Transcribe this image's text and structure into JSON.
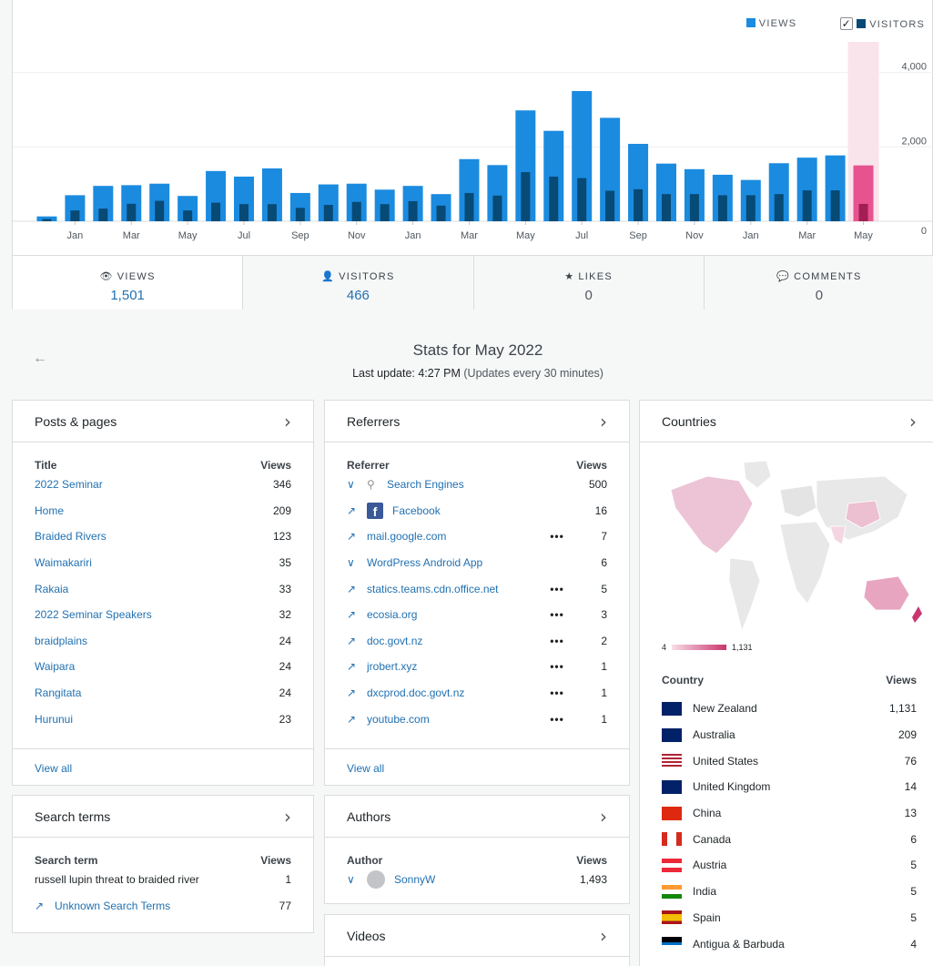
{
  "legend": {
    "views": "VIEWS",
    "visitors": "VISITORS",
    "visitors_checked": "✓"
  },
  "colors": {
    "views": "#1b8be0",
    "visitors": "#064a75",
    "highlight_views": "#e6538e",
    "highlight_visitors": "#a21e55",
    "highlight_band": "#f9e4ec"
  },
  "chart_data": {
    "type": "bar",
    "x_tick_labels": [
      "Jan",
      "Mar",
      "May",
      "Jul",
      "Sep",
      "Nov",
      "Jan",
      "Mar",
      "May",
      "Jul",
      "Sep",
      "Nov",
      "Jan",
      "Mar",
      "May"
    ],
    "y_tick_labels": [
      "4,000",
      "2,000",
      "0"
    ],
    "ylim": [
      0,
      4400
    ],
    "highlighted_index": 29,
    "series": [
      {
        "name": "VIEWS",
        "values": [
          130,
          700,
          950,
          970,
          1010,
          680,
          1350,
          1200,
          1420,
          760,
          990,
          1010,
          850,
          950,
          730,
          1670,
          1510,
          2980,
          2430,
          3500,
          2780,
          2080,
          1550,
          1400,
          1250,
          1110,
          1560,
          1710,
          1770,
          1501
        ]
      },
      {
        "name": "VISITORS",
        "values": [
          60,
          290,
          340,
          470,
          550,
          290,
          500,
          460,
          460,
          360,
          440,
          520,
          460,
          540,
          420,
          760,
          690,
          1320,
          1200,
          1160,
          820,
          860,
          730,
          730,
          700,
          700,
          730,
          830,
          830,
          466
        ]
      }
    ]
  },
  "tabs": [
    {
      "icon": "eye-icon",
      "glyph": "👁",
      "label": "VIEWS",
      "value": "1,501"
    },
    {
      "icon": "person-icon",
      "glyph": "👤",
      "label": "VISITORS",
      "value": "466"
    },
    {
      "icon": "star-icon",
      "glyph": "★",
      "label": "LIKES",
      "value": "0"
    },
    {
      "icon": "comment-icon",
      "glyph": "💬",
      "label": "COMMENTS",
      "value": "0"
    }
  ],
  "header": {
    "back_glyph": "←",
    "title": "Stats for May 2022",
    "last_update_label": "Last update: 4:27 PM",
    "update_note": "(Updates every 30 minutes)"
  },
  "posts": {
    "title": "Posts & pages",
    "col_title": "Title",
    "col_views": "Views",
    "rows": [
      {
        "label": "2022 Seminar",
        "value": "346"
      },
      {
        "label": "Home",
        "value": "209"
      },
      {
        "label": "Braided Rivers",
        "value": "123"
      },
      {
        "label": "Waimakariri",
        "value": "35"
      },
      {
        "label": "Rakaia",
        "value": "33"
      },
      {
        "label": "2022 Seminar Speakers",
        "value": "32"
      },
      {
        "label": "braidplains",
        "value": "24"
      },
      {
        "label": "Waipara",
        "value": "24"
      },
      {
        "label": "Rangitata",
        "value": "24"
      },
      {
        "label": "Hurunui",
        "value": "23"
      }
    ],
    "view_all": "View all"
  },
  "referrers": {
    "title": "Referrers",
    "col_title": "Referrer",
    "col_views": "Views",
    "rows": [
      {
        "icon": "chevron-down-icon",
        "label": "Search Engines",
        "value": "500",
        "has_search_icon": true,
        "dots": false
      },
      {
        "icon": "external-link-icon",
        "label": "Facebook",
        "value": "16",
        "facebook": true,
        "dots": false
      },
      {
        "icon": "external-link-icon",
        "label": "mail.google.com",
        "value": "7",
        "dots": true
      },
      {
        "icon": "chevron-down-icon",
        "label": "WordPress Android App",
        "value": "6",
        "dots": false
      },
      {
        "icon": "external-link-icon",
        "label": "statics.teams.cdn.office.net",
        "value": "5",
        "dots": true
      },
      {
        "icon": "external-link-icon",
        "label": "ecosia.org",
        "value": "3",
        "dots": true
      },
      {
        "icon": "external-link-icon",
        "label": "doc.govt.nz",
        "value": "2",
        "dots": true
      },
      {
        "icon": "external-link-icon",
        "label": "jrobert.xyz",
        "value": "1",
        "dots": true
      },
      {
        "icon": "external-link-icon",
        "label": "dxcprod.doc.govt.nz",
        "value": "1",
        "dots": true
      },
      {
        "icon": "external-link-icon",
        "label": "youtube.com",
        "value": "1",
        "dots": true
      }
    ],
    "dots_glyph": "•••",
    "fb_glyph": "f",
    "view_all": "View all"
  },
  "countries": {
    "title": "Countries",
    "scale_min": "4",
    "scale_max": "1,131",
    "col_title": "Country",
    "col_views": "Views",
    "rows": [
      {
        "label": "New Zealand",
        "value": "1,131",
        "flag": "nz"
      },
      {
        "label": "Australia",
        "value": "209",
        "flag": "au"
      },
      {
        "label": "United States",
        "value": "76",
        "flag": "us"
      },
      {
        "label": "United Kingdom",
        "value": "14",
        "flag": "uk"
      },
      {
        "label": "China",
        "value": "13",
        "flag": "cn"
      },
      {
        "label": "Canada",
        "value": "6",
        "flag": "ca"
      },
      {
        "label": "Austria",
        "value": "5",
        "flag": "at"
      },
      {
        "label": "India",
        "value": "5",
        "flag": "in"
      },
      {
        "label": "Spain",
        "value": "5",
        "flag": "es"
      },
      {
        "label": "Antigua & Barbuda",
        "value": "4",
        "flag": "ag"
      }
    ]
  },
  "search_terms": {
    "title": "Search terms",
    "col_title": "Search term",
    "col_views": "Views",
    "rows": [
      {
        "label": "russell lupin threat to braided river",
        "value": "1",
        "link": false
      },
      {
        "label": "Unknown Search Terms",
        "value": "77",
        "link": true
      }
    ]
  },
  "authors": {
    "title": "Authors",
    "col_title": "Author",
    "col_views": "Views",
    "rows": [
      {
        "label": "SonnyW",
        "value": "1,493"
      }
    ]
  },
  "videos": {
    "title": "Videos"
  },
  "glyphs": {
    "chevron_right": "›",
    "chevron_down": "∨",
    "external": "↗",
    "search": "⚲"
  }
}
